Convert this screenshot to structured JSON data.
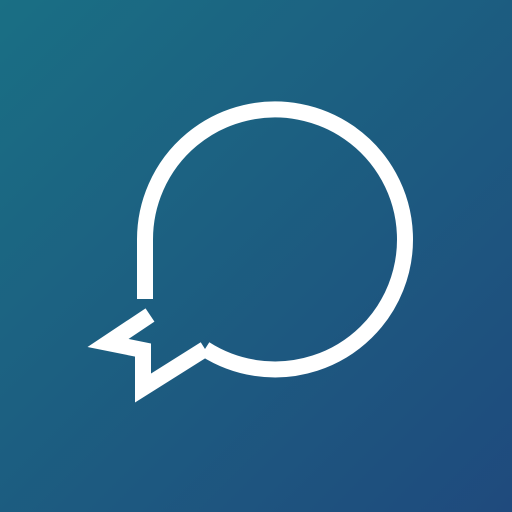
{
  "icon": {
    "name": "chat-bubble-icon",
    "colors": {
      "background_start": "#1a6f84",
      "background_end": "#1f4a7d",
      "glyph": "#ffffff"
    }
  }
}
